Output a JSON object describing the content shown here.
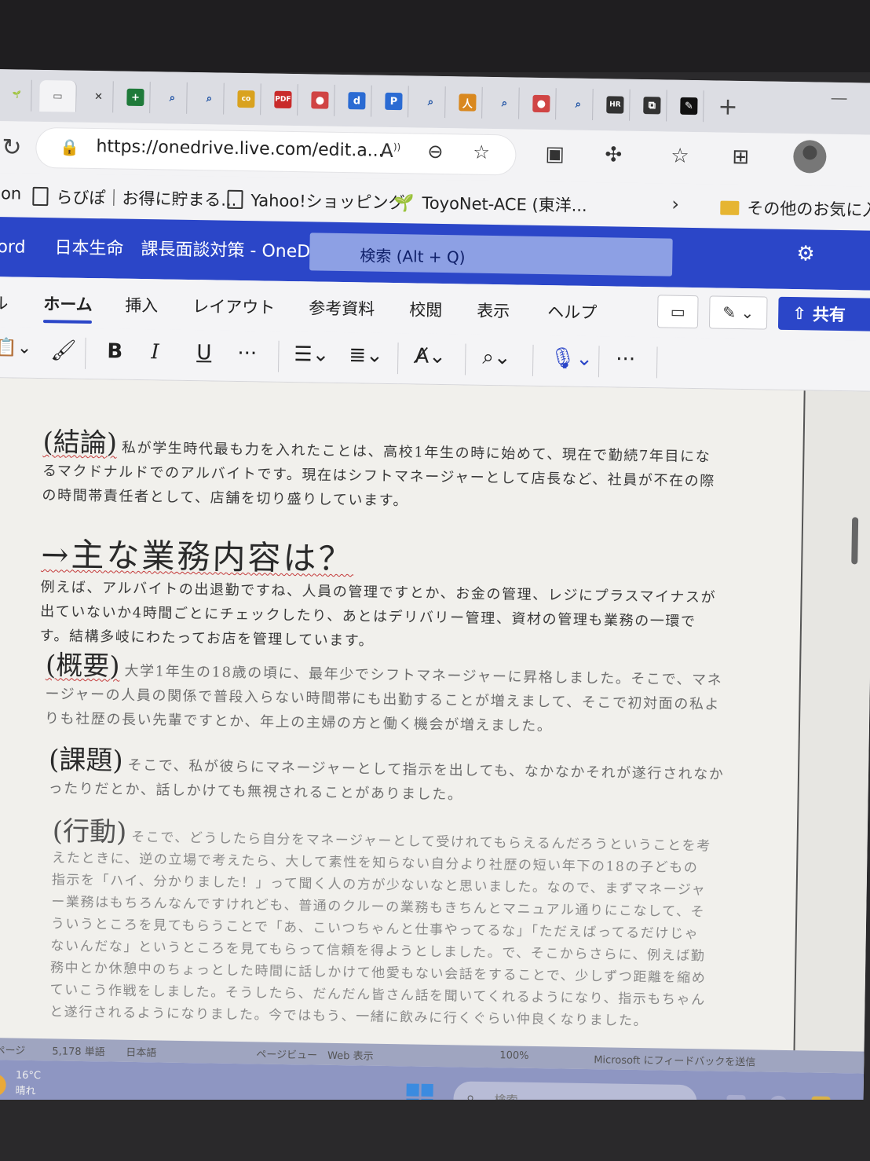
{
  "browser": {
    "tabs": [
      {
        "icon": "sprout-icon",
        "glyph": "🌱",
        "color": "#7a9a22"
      },
      {
        "icon": "page-icon",
        "glyph": "▭",
        "color": "#555"
      },
      {
        "icon": "close-icon",
        "glyph": "✕",
        "color": "#333"
      },
      {
        "icon": "plus-square-icon",
        "glyph": "+",
        "color": "#1f7a3a"
      },
      {
        "icon": "search-icon",
        "glyph": "⌕",
        "color": "#1a4fa3"
      },
      {
        "icon": "search-icon",
        "glyph": "⌕",
        "color": "#1a4fa3"
      },
      {
        "icon": "link-icon",
        "glyph": "co",
        "color": "#d9a21f"
      },
      {
        "icon": "pdf-icon",
        "glyph": "PDF",
        "color": "#c92a2a"
      },
      {
        "icon": "person-icon",
        "glyph": "●",
        "color": "#d04444"
      },
      {
        "icon": "d-icon",
        "glyph": "d",
        "color": "#2b6bd3"
      },
      {
        "icon": "p-icon",
        "glyph": "P",
        "color": "#2b6bd3"
      },
      {
        "icon": "search-icon",
        "glyph": "⌕",
        "color": "#1a4fa3"
      },
      {
        "icon": "person-orange-icon",
        "glyph": "人",
        "color": "#d9881f"
      },
      {
        "icon": "search-icon",
        "glyph": "⌕",
        "color": "#1a4fa3"
      },
      {
        "icon": "person-icon",
        "glyph": "●",
        "color": "#d04444"
      },
      {
        "icon": "search-icon",
        "glyph": "⌕",
        "color": "#1a4fa3"
      },
      {
        "icon": "hr-icon",
        "glyph": "HR",
        "color": "#333"
      },
      {
        "icon": "docs-icon",
        "glyph": "⧉",
        "color": "#333"
      },
      {
        "icon": "pen-icon",
        "glyph": "✎",
        "color": "#111"
      }
    ],
    "new_tab_icon": "plus-icon",
    "url": "https://onedrive.live.com/edit.a...",
    "read_aloud_label": "A",
    "bookmarks": [
      {
        "label": "con",
        "icon": "none"
      },
      {
        "label": "らびぽ｜お得に貯まる...",
        "icon": "doc-icon"
      },
      {
        "label": "Yahoo!ショッピング",
        "icon": "doc-icon"
      },
      {
        "label": "ToyoNet-ACE (東洋...",
        "icon": "sprout-icon"
      },
      {
        "label": "その他のお気に入",
        "icon": "folder-icon"
      }
    ]
  },
  "word": {
    "app_name_partial": "ord",
    "document_title": "日本生命　課長面談対策 - OneDrive に保存",
    "search_placeholder": "検索 (Alt + Q)",
    "ribbon_tabs": [
      "ル",
      "ホーム",
      "挿入",
      "レイアウト",
      "参考資料",
      "校閲",
      "表示",
      "ヘルプ"
    ],
    "active_tab": "ホーム",
    "share_label": "共有",
    "toolbar": {
      "bold": "B",
      "italic": "I",
      "underline": "U",
      "more": "···"
    }
  },
  "document": {
    "sections": [
      {
        "head": "(結論)",
        "body": "私が学生時代最も力を入れたことは、高校1年生の時に始めて、現在で勤続7年目になるマクドナルドでのアルバイトです。現在はシフトマネージャーとして店長など、社員が不在の際の時間帯責任者として、店舗を切り盛りしています。"
      },
      {
        "head": "→主な業務内容は？",
        "body": "例えば、アルバイトの出退勤ですね、人員の管理ですとか、お金の管理、レジにプラスマイナスが出ていないか4時間ごとにチェックしたり、あとはデリバリー管理、資材の管理も業務の一環です。結構多岐にわたってお店を管理しています。"
      },
      {
        "head": "(概要)",
        "body": "大学1年生の18歳の頃に、最年少でシフトマネージャーに昇格しました。そこで、マネージャーの人員の関係で普段入らない時間帯にも出勤することが増えまして、そこで初対面の私よりも社歴の長い先輩ですとか、年上の主婦の方と働く機会が増えました。"
      },
      {
        "head": "(課題)",
        "body": "そこで、私が彼らにマネージャーとして指示を出しても、なかなかそれが遂行されなかったりだとか、話しかけても無視されることがありました。"
      },
      {
        "head": "(行動)",
        "body": "そこで、どうしたら自分をマネージャーとして受けれてもらえるんだろうということを考えたときに、逆の立場で考えたら、大して素性を知らない自分より社歴の短い年下の18の子どもの指示を「ハイ、分かりました！」って聞く人の方が少ないなと思いました。なので、まずマネージャー業務はもちろんなんですけれども、普通のクルーの業務もきちんとマニュアル通りにこなして、そういうところを見てもらうことで「あ、こいつちゃんと仕事やってるな」「ただえばってるだけじゃないんだな」というところを見てもらって信頼を得ようとしました。で、そこからさらに、例えば勤務中とか休憩中のちょっとした時間に話しかけて他愛もない会話をすることで、少しずつ距離を縮めていこう作戦をしました。そうしたら、だんだん皆さん話を聞いてくれるようになり、指示もちゃんと遂行されるようになりました。今ではもう、一緒に飲みに行くぐらい仲良くなりました。"
      }
    ]
  },
  "statusbar": {
    "page": "の ページ",
    "words": "5,178 単語",
    "lang": "日本語",
    "views": "ページビュー　Web 表示",
    "zoom": "100%",
    "feedback": "Microsoft にフィードバックを送信"
  },
  "taskbar": {
    "temp": "16°C",
    "weather": "晴れ",
    "search_placeholder": "検索"
  }
}
